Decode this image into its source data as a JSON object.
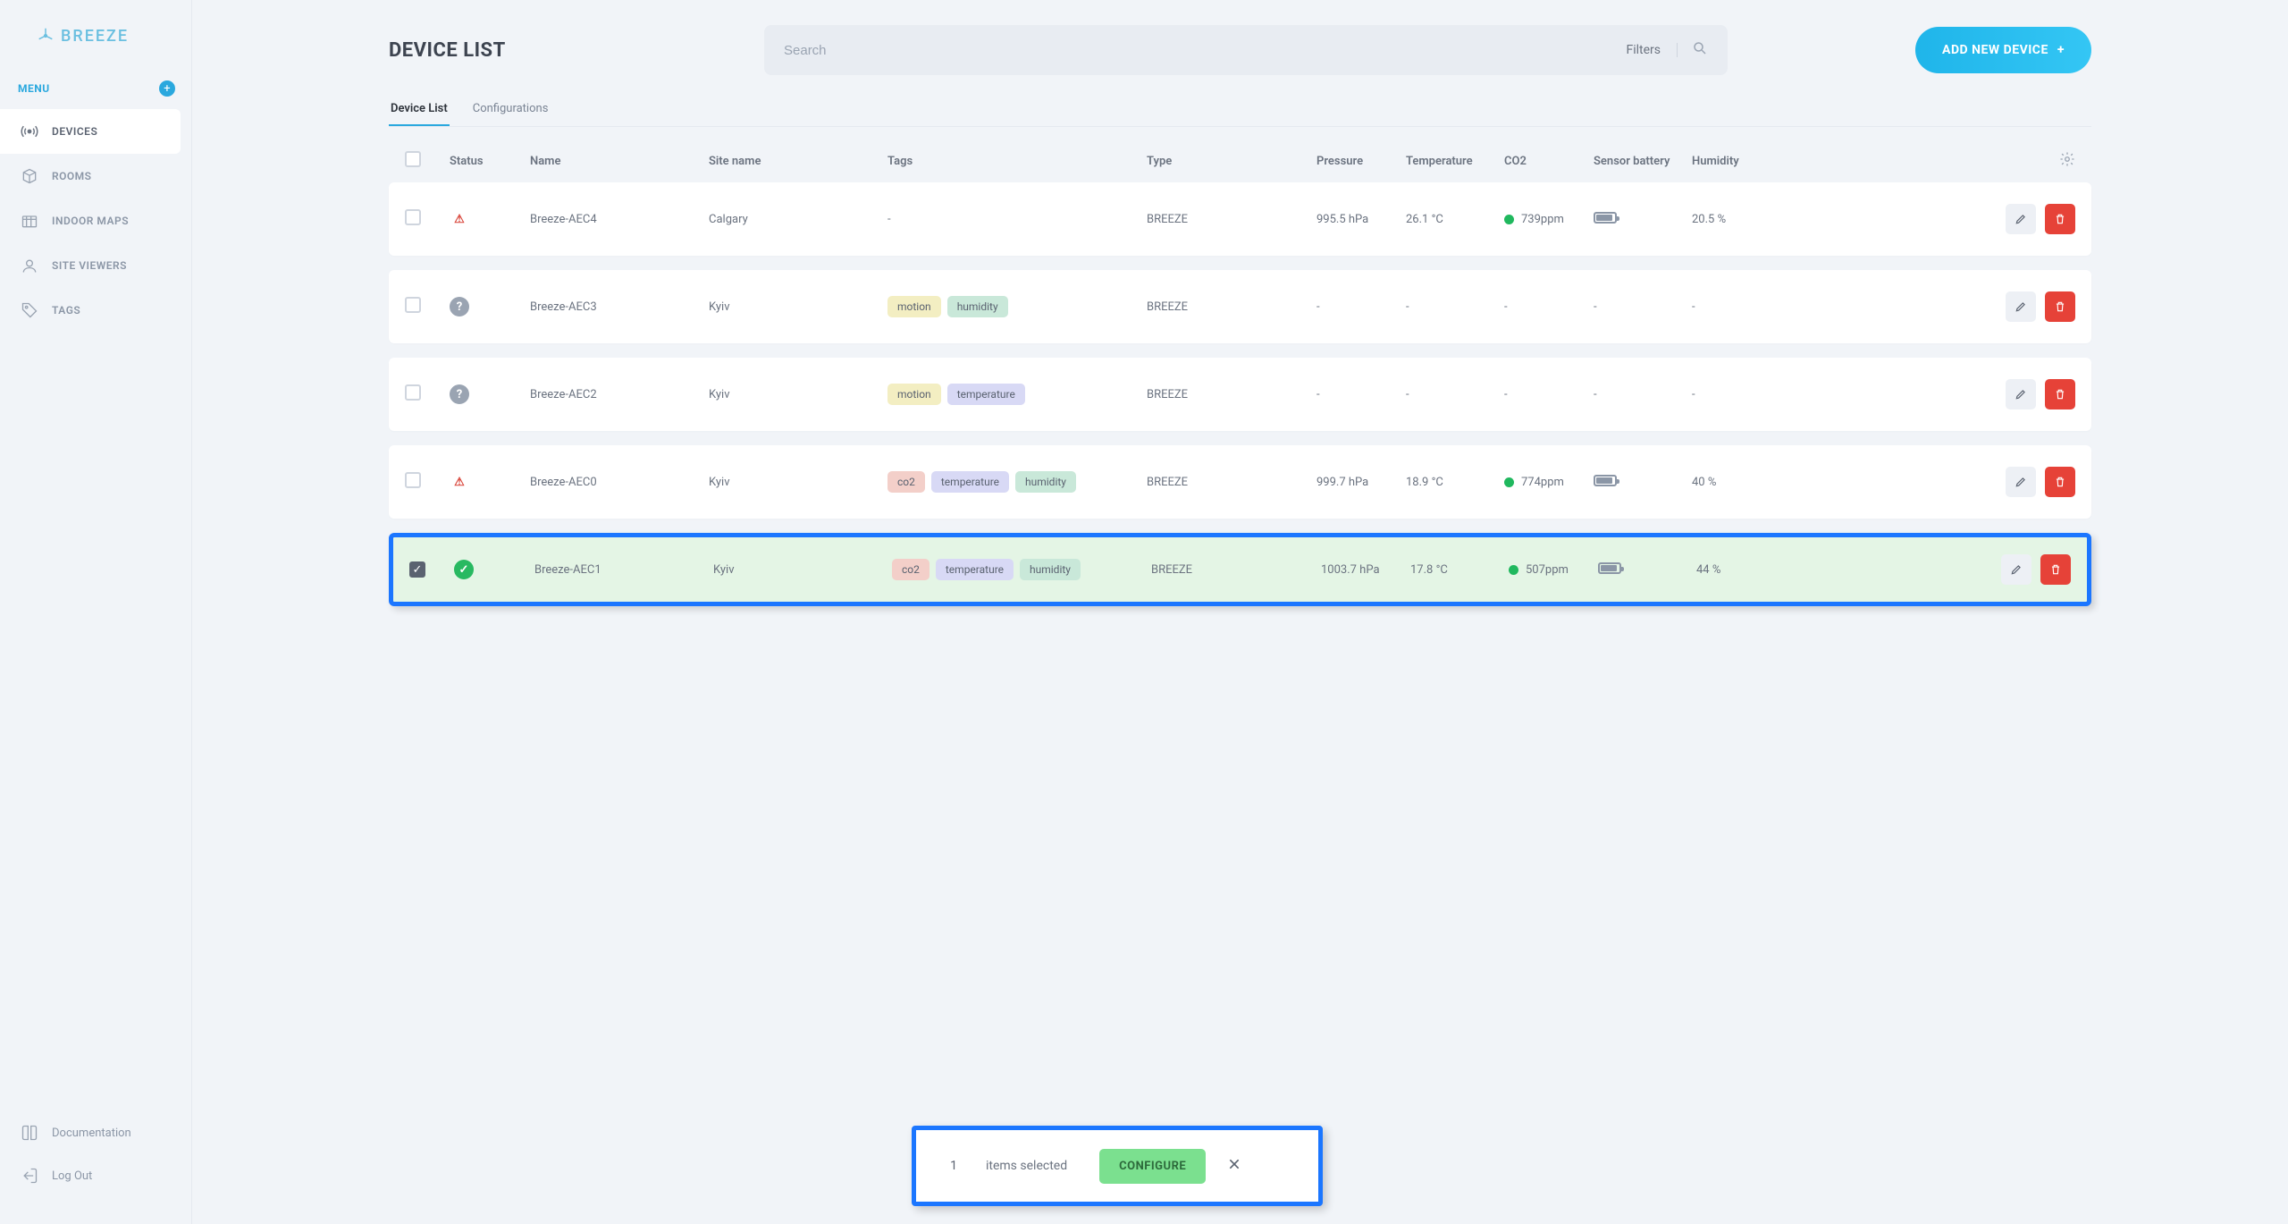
{
  "logo_text": "BREEZE",
  "menu_label": "MENU",
  "nav": [
    {
      "label": "DEVICES",
      "icon": "broadcast-icon",
      "active": true
    },
    {
      "label": "ROOMS",
      "icon": "box-icon",
      "active": false
    },
    {
      "label": "INDOOR MAPS",
      "icon": "map-icon",
      "active": false
    },
    {
      "label": "SITE VIEWERS",
      "icon": "user-icon",
      "active": false
    },
    {
      "label": "TAGS",
      "icon": "tag-icon",
      "active": false
    }
  ],
  "footer_nav": [
    {
      "label": "Documentation",
      "icon": "book-icon"
    },
    {
      "label": "Log Out",
      "icon": "logout-icon"
    }
  ],
  "page_title": "DEVICE LIST",
  "search": {
    "placeholder": "Search",
    "filters_label": "Filters"
  },
  "add_button": "ADD NEW DEVICE",
  "tabs": [
    {
      "label": "Device List",
      "active": true
    },
    {
      "label": "Configurations",
      "active": false
    }
  ],
  "columns": {
    "status": "Status",
    "name": "Name",
    "site": "Site name",
    "tags": "Tags",
    "type": "Type",
    "pressure": "Pressure",
    "temperature": "Temperature",
    "co2": "CO2",
    "battery": "Sensor battery",
    "humidity": "Humidity"
  },
  "rows": [
    {
      "checked": false,
      "status": "warn",
      "name": "Breeze-AEC4",
      "site": "Calgary",
      "tags": [],
      "tags_placeholder": "-",
      "type": "BREEZE",
      "pressure": "995.5 hPa",
      "temperature": "26.1 °C",
      "co2": "739ppm",
      "co2_dot": true,
      "battery": true,
      "humidity": "20.5 %",
      "selected": false
    },
    {
      "checked": false,
      "status": "unknown",
      "name": "Breeze-AEC3",
      "site": "Kyiv",
      "tags": [
        "motion",
        "humidity"
      ],
      "type": "BREEZE",
      "pressure": "-",
      "temperature": "-",
      "co2": "-",
      "co2_dot": false,
      "battery": false,
      "battery_placeholder": "-",
      "humidity": "-",
      "selected": false
    },
    {
      "checked": false,
      "status": "unknown",
      "name": "Breeze-AEC2",
      "site": "Kyiv",
      "tags": [
        "motion",
        "temperature"
      ],
      "type": "BREEZE",
      "pressure": "-",
      "temperature": "-",
      "co2": "-",
      "co2_dot": false,
      "battery": false,
      "battery_placeholder": "-",
      "humidity": "-",
      "selected": false
    },
    {
      "checked": false,
      "status": "warn",
      "name": "Breeze-AEC0",
      "site": "Kyiv",
      "tags": [
        "co2",
        "temperature",
        "humidity"
      ],
      "type": "BREEZE",
      "pressure": "999.7 hPa",
      "temperature": "18.9 °C",
      "co2": "774ppm",
      "co2_dot": true,
      "battery": true,
      "humidity": "40 %",
      "selected": false
    },
    {
      "checked": true,
      "status": "ok",
      "name": "Breeze-AEC1",
      "site": "Kyiv",
      "tags": [
        "co2",
        "temperature",
        "humidity"
      ],
      "type": "BREEZE",
      "pressure": "1003.7 hPa",
      "temperature": "17.8 °C",
      "co2": "507ppm",
      "co2_dot": true,
      "battery": true,
      "humidity": "44 %",
      "selected": true
    }
  ],
  "selection_bar": {
    "count": "1",
    "text": "items selected",
    "button": "CONFIGURE"
  },
  "tag_colors": {
    "motion": "tag-motion",
    "humidity": "tag-humidity",
    "temperature": "tag-temperature",
    "co2": "tag-co2"
  },
  "status": {
    "warn_glyph": "⚠",
    "unknown_glyph": "?",
    "ok_glyph": "✓"
  }
}
